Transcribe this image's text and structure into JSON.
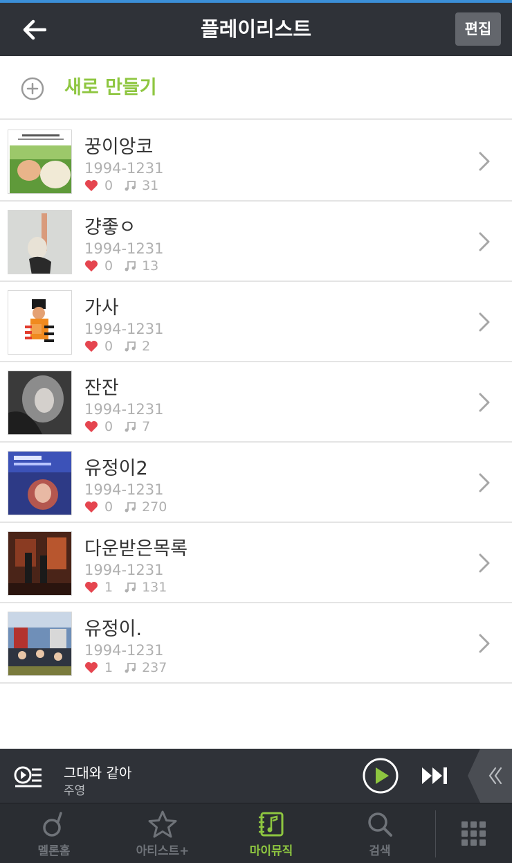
{
  "header": {
    "title": "플레이리스트",
    "edit_label": "편집"
  },
  "new_playlist": {
    "label": "새로 만들기"
  },
  "playlists": [
    {
      "title": "꿍이앙코",
      "date": "1994-1231",
      "likes": "0",
      "tracks": "31"
    },
    {
      "title": "걍좋ㅇ",
      "date": "1994-1231",
      "likes": "0",
      "tracks": "13"
    },
    {
      "title": "가사",
      "date": "1994-1231",
      "likes": "0",
      "tracks": "2"
    },
    {
      "title": "잔잔",
      "date": "1994-1231",
      "likes": "0",
      "tracks": "7"
    },
    {
      "title": "유정이2",
      "date": "1994-1231",
      "likes": "0",
      "tracks": "270"
    },
    {
      "title": "다운받은목록",
      "date": "1994-1231",
      "likes": "1",
      "tracks": "131"
    },
    {
      "title": "유정이.",
      "date": "1994-1231",
      "likes": "1",
      "tracks": "237"
    }
  ],
  "player": {
    "song_title": "그대와 같아",
    "artist": "주영"
  },
  "tabs": [
    {
      "label": "멜론홈",
      "icon": "melon-home-icon",
      "active": false
    },
    {
      "label": "아티스트+",
      "icon": "star-icon",
      "active": false
    },
    {
      "label": "마이뮤직",
      "icon": "my-music-icon",
      "active": true
    },
    {
      "label": "검색",
      "icon": "search-icon",
      "active": false
    }
  ],
  "colors": {
    "accent": "#8ec640",
    "header_bg": "#2f3238",
    "heart": "#e5454f"
  }
}
